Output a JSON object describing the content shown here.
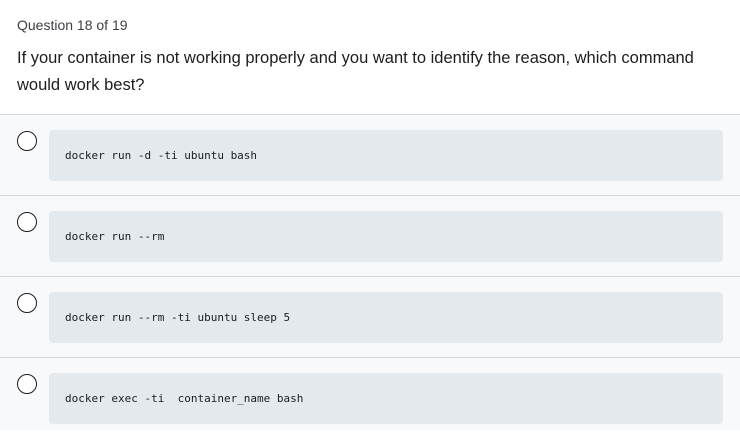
{
  "question": {
    "counter": "Question 18 of 19",
    "prompt": "If your container is not working properly and you want to identify the reason, which command would work best?"
  },
  "answers": [
    {
      "code": "docker run -d -ti ubuntu bash"
    },
    {
      "code": "docker run --rm"
    },
    {
      "code": "docker run --rm -ti ubuntu sleep 5"
    },
    {
      "code": "docker exec -ti  container_name bash"
    }
  ]
}
